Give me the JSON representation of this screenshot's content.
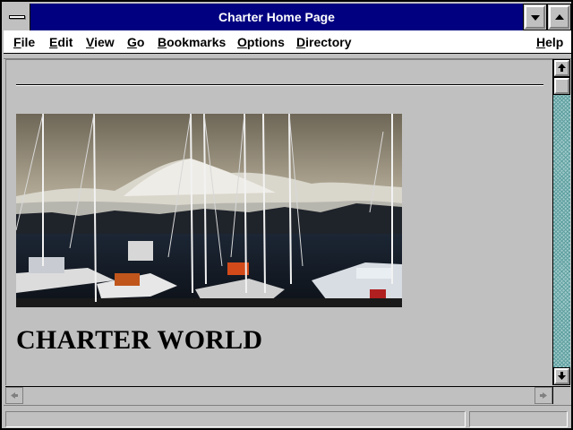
{
  "window": {
    "title": "Charter Home Page"
  },
  "menu": {
    "file": "File",
    "edit": "Edit",
    "view": "View",
    "go": "Go",
    "bookmarks": "Bookmarks",
    "options": "Options",
    "directory": "Directory",
    "help": "Help"
  },
  "page": {
    "heading": "CHARTER WORLD",
    "image_icon": "marina-photo"
  },
  "status": {
    "text": "",
    "progress": 0
  },
  "icons": {
    "system_menu": "system-menu-icon",
    "minimize": "minimize-icon",
    "maximize": "maximize-icon",
    "scroll_up": "arrow-up-icon",
    "scroll_down": "arrow-down-icon",
    "scroll_left": "arrow-left-icon",
    "scroll_right": "arrow-right-icon"
  },
  "colors": {
    "titlebar": "#000080",
    "face": "#c0c0c0",
    "scroll_track": "#9fc9c9"
  }
}
